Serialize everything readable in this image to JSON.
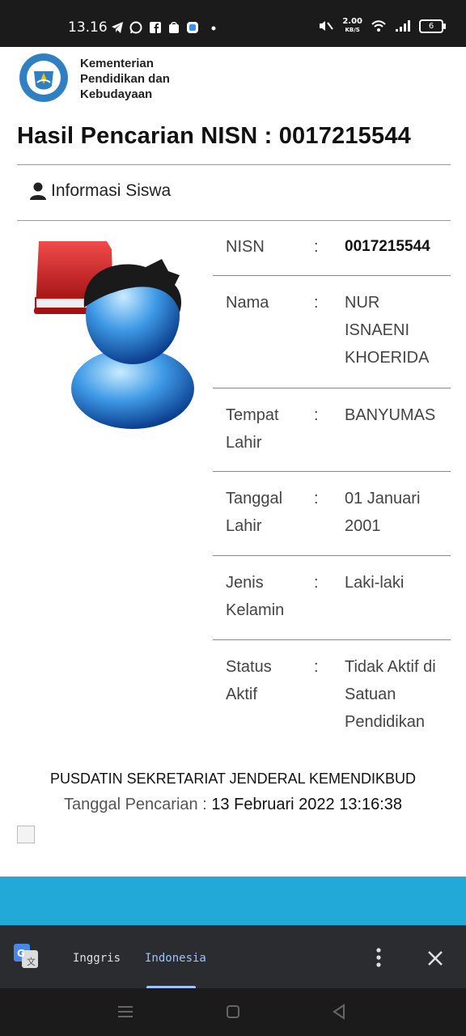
{
  "status_bar": {
    "time": "13.16",
    "net_speed": "2.00",
    "net_unit": "KB/S",
    "battery": "6"
  },
  "header": {
    "org_name_line1": "Kementerian",
    "org_name_line2": "Pendidikan dan",
    "org_name_line3": "Kebudayaan"
  },
  "page": {
    "title": "Hasil Pencarian NISN : 0017215544",
    "section_title": "Informasi Siswa"
  },
  "student": {
    "rows": [
      {
        "label": "NISN",
        "colon": ":",
        "value": "0017215544"
      },
      {
        "label": "Nama",
        "colon": ":",
        "value": "NUR ISNAENI KHOERIDA"
      },
      {
        "label": "Tempat Lahir",
        "colon": ":",
        "value": "BANYUMAS"
      },
      {
        "label": "Tanggal Lahir",
        "colon": ":",
        "value": "01 Januari 2001"
      },
      {
        "label": "Jenis Kelamin",
        "colon": ":",
        "value": "Laki-laki"
      },
      {
        "label": "Status Aktif",
        "colon": ":",
        "value": "Tidak Aktif di Satuan Pendidikan"
      }
    ]
  },
  "footer": {
    "org": "PUSDATIN SEKRETARIAT JENDERAL KEMENDIKBUD",
    "date_label": "Tanggal Pencarian :",
    "date_value": "13 Februari 2022 13:16:38"
  },
  "translate_bar": {
    "tab_source": "Inggris",
    "tab_target": "Indonesia",
    "active_tab": "Indonesia",
    "accent_color": "#9ec2ff"
  },
  "colors": {
    "accent_blue": "#22a9d8",
    "status_bar": "#1b1b1b"
  }
}
